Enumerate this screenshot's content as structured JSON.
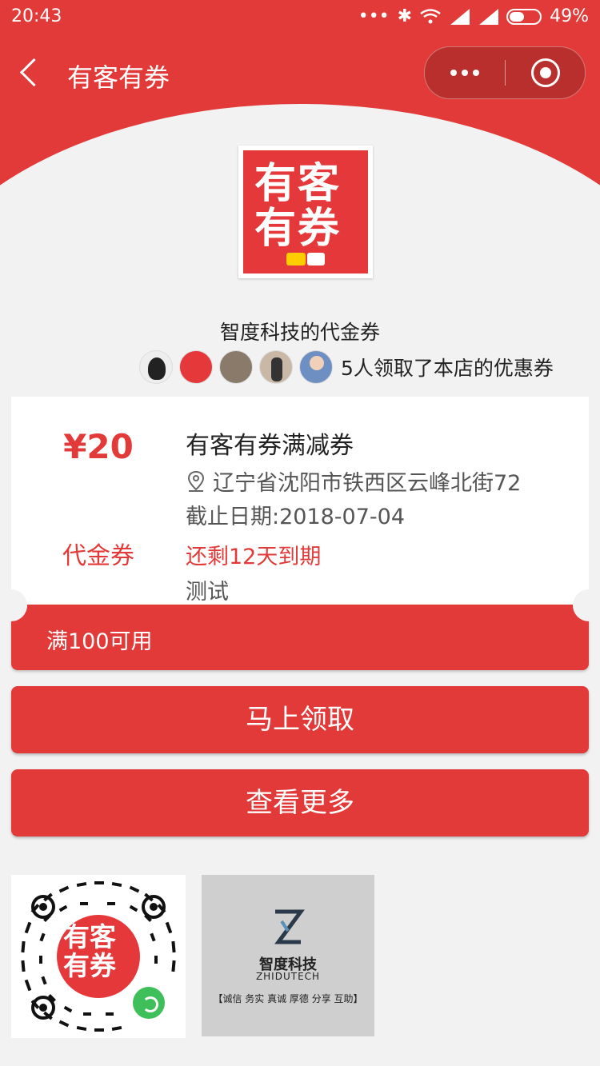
{
  "status_bar": {
    "time": "20:43",
    "battery": "49%"
  },
  "nav": {
    "title": "有客有券"
  },
  "shop": {
    "logo_text": "有客有券",
    "title": "智度科技的代金券",
    "takers_text": "5人领取了本店的优惠券"
  },
  "coupon": {
    "amount": "¥20",
    "type": "代金券",
    "title": "有客有券满减券",
    "address": "辽宁省沈阳市铁西区云峰北街72",
    "expiry": "截止日期:2018-07-04",
    "remaining": "还剩12天到期",
    "note": "测试",
    "condition": "满100可用"
  },
  "buttons": {
    "claim": "马上领取",
    "more": "查看更多"
  },
  "qr_card": {
    "logo_text": "有客有券"
  },
  "brand_card": {
    "name": "智度科技",
    "english": "ZHIDUTECH",
    "slogan": "【诚信 务实 真诚 厚德 分享 互助】"
  },
  "colors": {
    "accent": "#e23a38",
    "background": "#f2f2f2"
  }
}
